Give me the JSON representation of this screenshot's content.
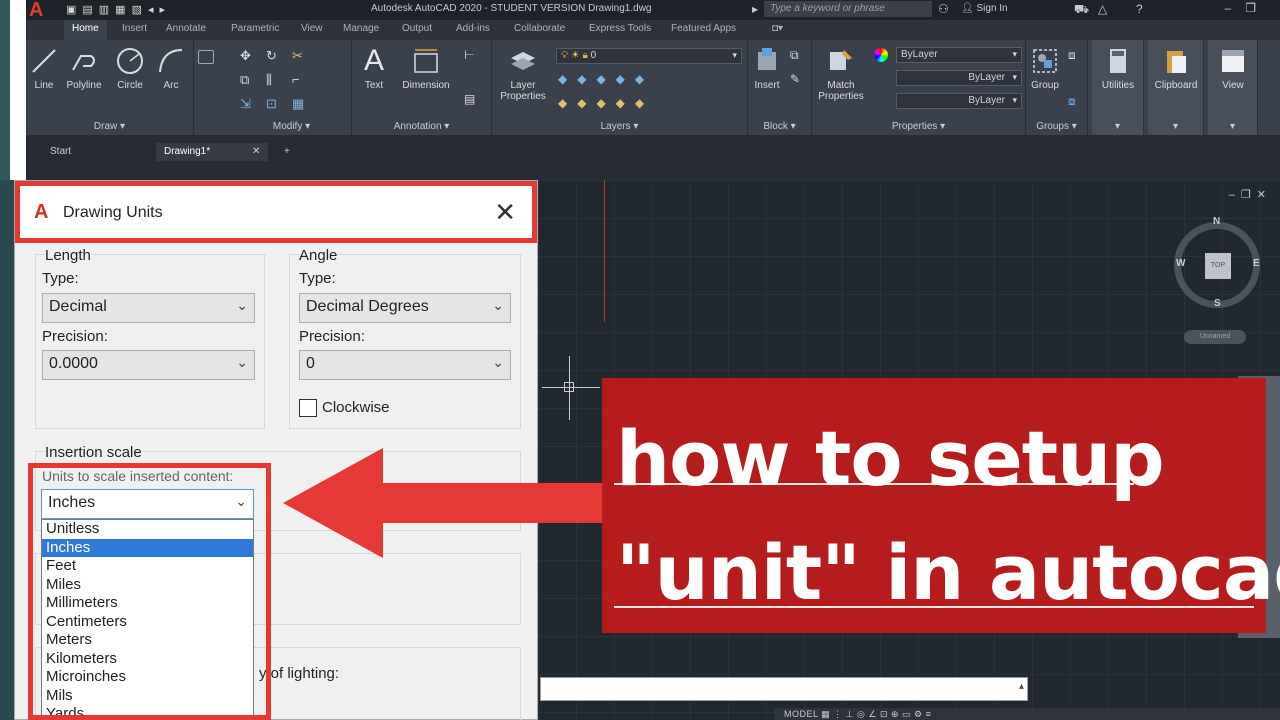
{
  "acad": {
    "window_title": "Autodesk AutoCAD 2020 - STUDENT VERSION    Drawing1.dwg",
    "search_placeholder": "Type a keyword or phrase",
    "signin": "Sign In",
    "ribbon_tabs": [
      "Home",
      "Insert",
      "Annotate",
      "Parametric",
      "View",
      "Manage",
      "Output",
      "Add-ins",
      "Collaborate",
      "Express Tools",
      "Featured Apps"
    ],
    "draw": {
      "line": "Line",
      "polyline": "Polyline",
      "circle": "Circle",
      "arc": "Arc",
      "panel": "Draw ▾"
    },
    "modify": {
      "panel": "Modify ▾"
    },
    "annotation": {
      "text": "Text",
      "dimension": "Dimension",
      "panel": "Annotation ▾"
    },
    "layers": {
      "layer_properties": "Layer Properties",
      "layer_value": "0",
      "panel": "Layers ▾"
    },
    "block": {
      "insert": "Insert",
      "panel": "Block ▾"
    },
    "properties": {
      "match": "Match Properties",
      "bylayer1": "ByLayer",
      "bylayer2": "ByLayer",
      "bylayer3": "ByLayer",
      "panel": "Properties ▾"
    },
    "groups": {
      "group": "Group",
      "panel": "Groups ▾"
    },
    "utilities": "Utilities",
    "clipboard": "Clipboard",
    "view": "View",
    "doc_tabs": {
      "start": "Start",
      "drawing": "Drawing1*"
    }
  },
  "viewcube": {
    "n": "N",
    "s": "S",
    "w": "W",
    "e": "E",
    "face": "TOP",
    "wcs": "Unnamed"
  },
  "status": {
    "model": "MODEL"
  },
  "dialog": {
    "title": "Drawing Units",
    "length": {
      "group": "Length",
      "type_label": "Type:",
      "type_value": "Decimal",
      "precision_label": "Precision:",
      "precision_value": "0.0000"
    },
    "angle": {
      "group": "Angle",
      "type_label": "Type:",
      "type_value": "Decimal Degrees",
      "precision_label": "Precision:",
      "precision_value": "0",
      "clockwise": "Clockwise"
    },
    "insertion": {
      "group": "Insertion scale",
      "label": "Units to scale inserted content:",
      "value": "Inches",
      "options": [
        "Unitless",
        "Inches",
        "Feet",
        "Miles",
        "Millimeters",
        "Centimeters",
        "Meters",
        "Kilometers",
        "Microinches",
        "Mils",
        "Yards"
      ],
      "selected_index": 1
    },
    "lighting_fragment": "y of lighting:"
  },
  "banner": {
    "line1": "how to setup",
    "line2": "\"unit\" in autocad"
  },
  "colors": {
    "highlight_red": "#e53935",
    "banner_red": "#b71c1c",
    "selection_blue": "#2f7ad8"
  }
}
